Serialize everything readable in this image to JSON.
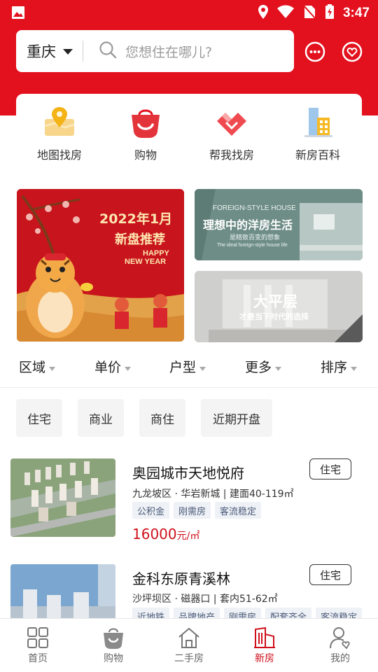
{
  "status_bar": {
    "time": "3:47"
  },
  "header": {
    "city": "重庆",
    "search_placeholder": "您想住在哪儿?"
  },
  "quick_nav": [
    {
      "label": "地图找房",
      "icon": "map-pin-icon"
    },
    {
      "label": "购物",
      "icon": "shopping-bag-icon"
    },
    {
      "label": "帮我找房",
      "icon": "heart-diamond-icon"
    },
    {
      "label": "新房百科",
      "icon": "buildings-icon"
    }
  ],
  "banners": {
    "main": {
      "title": "2022年1月",
      "subtitle": "新盘推荐",
      "line3": "HAPPY",
      "line4": "NEW YEAR"
    },
    "side1": {
      "en": "FOREIGN-STYLE HOUSE",
      "title": "理想中的洋房生活",
      "sub": "是精致百变的想象",
      "en2": "The ideal foreign-style house life"
    },
    "side2": {
      "title": "大平层",
      "sub": "才是当下时代的选择"
    }
  },
  "filters": [
    "区域",
    "单价",
    "户型",
    "更多",
    "排序"
  ],
  "chips": [
    "住宅",
    "商业",
    "商住",
    "近期开盘"
  ],
  "listings": [
    {
      "title": "奥园城市天地悦府",
      "type": "住宅",
      "meta": "九龙坡区 · 华岩新城 | 建面40-119㎡",
      "tags": [
        "公积金",
        "刚需房",
        "客流稳定"
      ],
      "price": "16000",
      "price_unit": "元/㎡"
    },
    {
      "title": "金科东原青溪林",
      "type": "住宅",
      "meta": "沙坪坝区 · 磁器口 | 套内51-62㎡",
      "tags": [
        "近地铁",
        "品牌地产",
        "刚需房",
        "配套齐全",
        "客流稳定"
      ]
    }
  ],
  "bottom_nav": [
    {
      "label": "首页",
      "icon": "grid-icon"
    },
    {
      "label": "购物",
      "icon": "shopping-bag-icon"
    },
    {
      "label": "二手房",
      "icon": "house-icon"
    },
    {
      "label": "新房",
      "icon": "building-icon",
      "active": true
    },
    {
      "label": "我的",
      "icon": "user-icon"
    }
  ],
  "colors": {
    "brand_red": "#e3101e",
    "price_red": "#d0101c",
    "tag_bg": "#eef1f6"
  }
}
